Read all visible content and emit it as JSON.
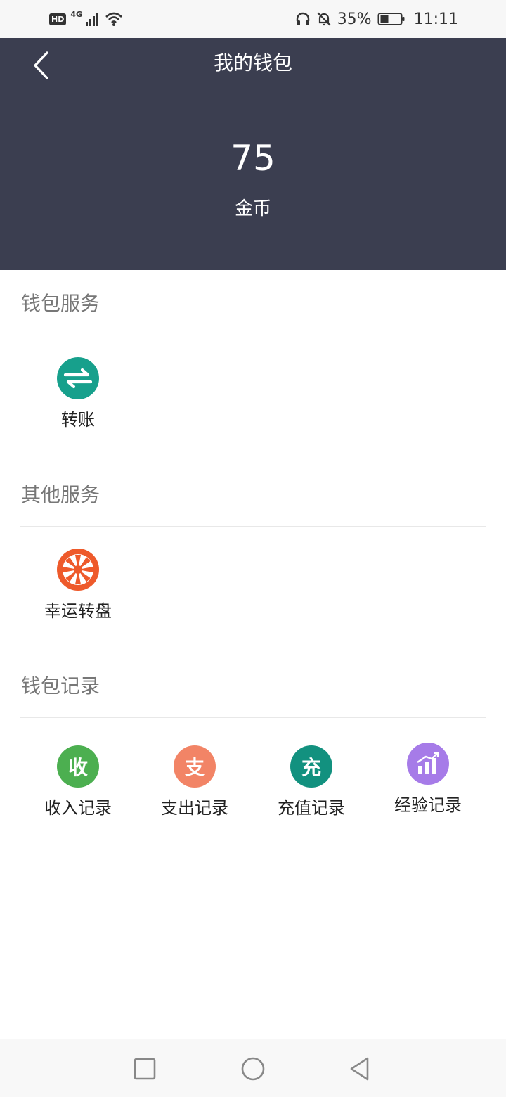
{
  "status_bar": {
    "hd": "HD",
    "network": "4G",
    "battery": "35%",
    "time": "11:11",
    "icons": [
      "signal-icon",
      "wifi-icon",
      "headphones-icon",
      "mute-icon",
      "battery-icon"
    ]
  },
  "header": {
    "title": "我的钱包",
    "balance": "75",
    "unit": "金币"
  },
  "sections": {
    "wallet_service": {
      "title": "钱包服务",
      "items": [
        {
          "label": "转账",
          "icon": "transfer-icon",
          "color": "#17a08c"
        }
      ]
    },
    "other_service": {
      "title": "其他服务",
      "items": [
        {
          "label": "幸运转盘",
          "icon": "lucky-wheel-icon",
          "color": "#ee5a2b"
        }
      ]
    },
    "wallet_records": {
      "title": "钱包记录",
      "items": [
        {
          "label": "收入记录",
          "icon_text": "收",
          "color": "#4caf50"
        },
        {
          "label": "支出记录",
          "icon_text": "支",
          "color": "#f28466"
        },
        {
          "label": "充值记录",
          "icon_text": "充",
          "color": "#12917f"
        },
        {
          "label": "经验记录",
          "icon": "chart-icon",
          "color": "#a67be8"
        }
      ]
    }
  },
  "nav": {
    "icons": [
      "recent-apps-icon",
      "home-icon",
      "back-nav-icon"
    ]
  }
}
